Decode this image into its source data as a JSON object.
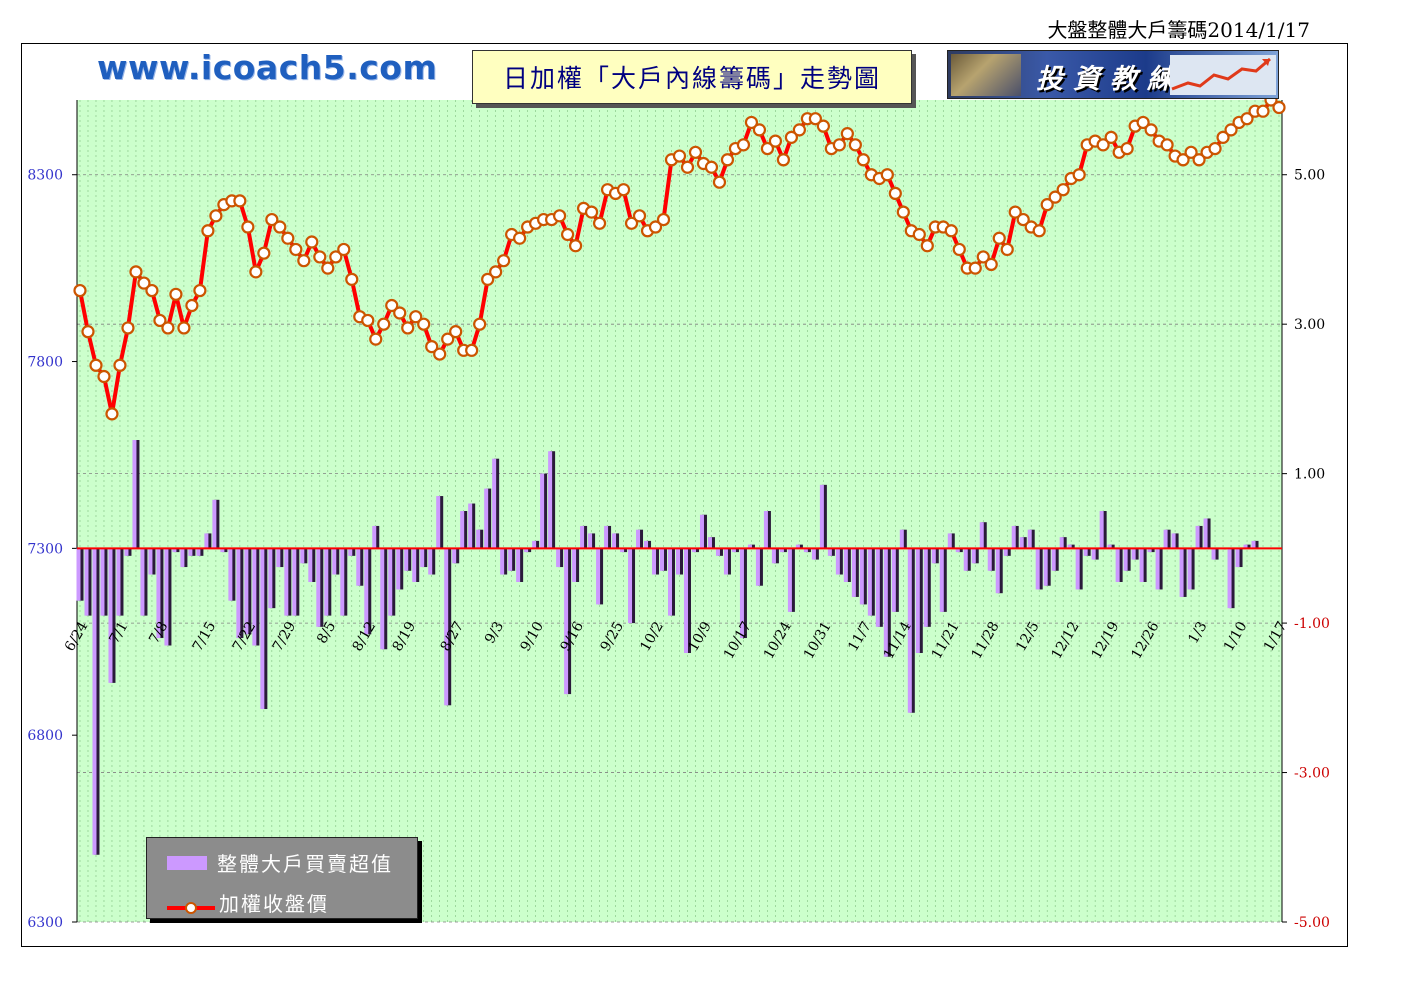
{
  "page_title": "大盤整體大戶籌碼2014/1/17",
  "site_url": "www.icoach5.com",
  "chart_title": "日加權「大戶內線籌碼」走勢圖",
  "logo_text": "投資教練",
  "legend": {
    "bar_label": "整體大戶買賣超值",
    "line_label": "加權收盤價"
  },
  "colors": {
    "plot_bg": "#ccffcc",
    "bar": "#cc99ff",
    "line": "#ff0000",
    "marker_edge": "#cc5500",
    "left_axis_text": "#3333cc",
    "right_axis_text": "#000000",
    "right_axis_neg_text": "#cc0000",
    "zero_line": "#ff0000"
  },
  "chart_data": {
    "type": "bar+line",
    "left_axis": {
      "min": 6300,
      "max": 8500,
      "ticks": [
        6300,
        6800,
        7300,
        7800,
        8300
      ]
    },
    "right_axis": {
      "min": -5,
      "max": 6,
      "ticks": [
        "5.00",
        "3.00",
        "1.00",
        "-1.00",
        "-3.00",
        "-5.00"
      ],
      "tick_values": [
        5,
        3,
        1,
        -1,
        -3,
        -5
      ]
    },
    "x_labels": [
      "6/24",
      "7/1",
      "7/8",
      "7/15",
      "7/22",
      "7/29",
      "8/5",
      "8/12",
      "8/19",
      "8/27",
      "9/3",
      "9/10",
      "9/16",
      "9/25",
      "10/2",
      "10/9",
      "10/17",
      "10/24",
      "10/31",
      "11/7",
      "11/14",
      "11/21",
      "11/28",
      "12/5",
      "12/12",
      "12/19",
      "12/26",
      "1/3",
      "1/10",
      "1/17"
    ],
    "series": [
      {
        "name": "加權收盤價",
        "axis": "left",
        "values": [
          7990,
          7880,
          7790,
          7760,
          7660,
          7790,
          7890,
          8040,
          8010,
          7990,
          7910,
          7890,
          7980,
          7890,
          7950,
          7990,
          8150,
          8190,
          8220,
          8230,
          8230,
          8160,
          8040,
          8090,
          8180,
          8160,
          8130,
          8100,
          8070,
          8120,
          8080,
          8050,
          8080,
          8100,
          8020,
          7920,
          7910,
          7860,
          7900,
          7950,
          7930,
          7890,
          7920,
          7900,
          7840,
          7820,
          7860,
          7880,
          7830,
          7830,
          7900,
          8020,
          8040,
          8070,
          8140,
          8130,
          8160,
          8170,
          8180,
          8180,
          8190,
          8140,
          8110,
          8210,
          8200,
          8170,
          8260,
          8250,
          8260,
          8170,
          8190,
          8150,
          8160,
          8180,
          8340,
          8350,
          8320,
          8360,
          8330,
          8320,
          8280,
          8340,
          8370,
          8380,
          8440,
          8420,
          8370,
          8390,
          8340,
          8400,
          8420,
          8450,
          8450,
          8430,
          8370,
          8380,
          8410,
          8380,
          8340,
          8300,
          8290,
          8300,
          8250,
          8200,
          8150,
          8140,
          8110,
          8160,
          8160,
          8150,
          8100,
          8050,
          8050,
          8080,
          8060,
          8130,
          8100,
          8200,
          8180,
          8160,
          8150,
          8220,
          8240,
          8260,
          8290,
          8300,
          8380,
          8390,
          8380,
          8400,
          8360,
          8370,
          8430,
          8440,
          8420,
          8390,
          8380,
          8350,
          8340,
          8360,
          8340,
          8360,
          8370,
          8400,
          8420,
          8440,
          8450,
          8470,
          8470,
          8500,
          8480
        ]
      },
      {
        "name": "整體大戶買賣超值",
        "axis": "right",
        "values": [
          -0.7,
          -0.9,
          -4.1,
          -0.9,
          -1.8,
          -0.9,
          -0.1,
          1.45,
          -0.9,
          -0.35,
          -1.2,
          -1.3,
          -0.05,
          -0.25,
          -0.1,
          -0.1,
          0.2,
          0.65,
          -0.05,
          -0.7,
          -1.2,
          -1.15,
          -1.3,
          -2.15,
          -0.8,
          -0.25,
          -0.9,
          -0.9,
          -0.2,
          -0.45,
          -1.05,
          -0.9,
          -0.35,
          -0.9,
          -0.1,
          -0.5,
          -1.15,
          0.3,
          -1.35,
          -0.9,
          -0.55,
          -0.3,
          -0.45,
          -0.25,
          -0.35,
          0.7,
          -2.1,
          -0.2,
          0.5,
          0.6,
          0.25,
          0.8,
          1.2,
          -0.35,
          -0.3,
          -0.45,
          -0.05,
          0.1,
          1.0,
          1.3,
          -0.25,
          -1.95,
          -0.45,
          0.3,
          0.2,
          -0.75,
          0.3,
          0.2,
          -0.05,
          -1.0,
          0.25,
          0.1,
          -0.35,
          -0.3,
          -0.9,
          -0.35,
          -1.4,
          -0.05,
          0.45,
          0.15,
          -0.1,
          -0.35,
          -0.05,
          -1.2,
          0.05,
          -0.5,
          0.5,
          -0.2,
          -0.05,
          -0.85,
          0.05,
          -0.05,
          -0.15,
          0.85,
          -0.1,
          -0.35,
          -0.45,
          -0.65,
          -0.75,
          -0.9,
          -1.05,
          -1.45,
          -0.85,
          0.25,
          -2.2,
          -1.4,
          -1.05,
          -0.2,
          -0.85,
          0.2,
          -0.05,
          -0.3,
          -0.2,
          0.35,
          -0.3,
          -0.6,
          -0.1,
          0.3,
          0.15,
          0.25,
          -0.55,
          -0.5,
          -0.3,
          0.15,
          0.05,
          -0.55,
          -0.1,
          -0.15,
          0.5,
          0.05,
          -0.45,
          -0.3,
          -0.15,
          -0.45,
          -0.05,
          -0.55,
          0.25,
          0.2,
          -0.65,
          -0.55,
          0.3,
          0.4,
          -0.15,
          0.0,
          -0.8,
          -0.25,
          0.05,
          0.1
        ]
      }
    ],
    "grid": true,
    "legend_position": "bottom-left"
  }
}
